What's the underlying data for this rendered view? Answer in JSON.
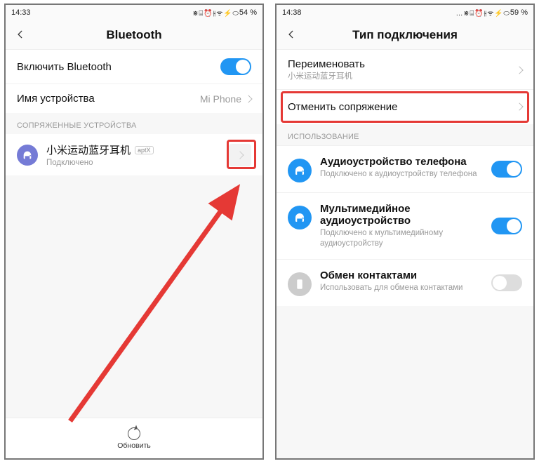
{
  "left": {
    "status": {
      "time": "14:33",
      "battery": "54 %",
      "icons": "⋇ ⌸ ⏰ ⫳ ᯤ ⚡ ⬭"
    },
    "header": {
      "title": "Bluetooth"
    },
    "rows": {
      "enable": "Включить Bluetooth",
      "device_name_label": "Имя устройства",
      "device_name_value": "Mi Phone"
    },
    "section_paired": "СОПРЯЖЕННЫЕ УСТРОЙСТВА",
    "device": {
      "name": "小米运动蓝牙耳机",
      "badge": "aptX",
      "status": "Подключено"
    },
    "bottom": {
      "refresh": "Обновить"
    }
  },
  "right": {
    "status": {
      "time": "14:38",
      "battery": "59 %",
      "icons": "… ⋇ ⌸ ⏰ ⫳ ᯤ ⚡ ⬭"
    },
    "header": {
      "title": "Тип подключения"
    },
    "rename": {
      "label": "Переименовать",
      "sub": "小米运动蓝牙耳机"
    },
    "unpair": {
      "label": "Отменить сопряжение"
    },
    "section_usage": "ИСПОЛЬЗОВАНИЕ",
    "usage": {
      "phone_audio": {
        "title": "Аудиоустройство телефона",
        "sub": "Подключено к аудиоустройству телефона"
      },
      "media_audio": {
        "title": "Мультимедийное аудиоустройство",
        "sub": "Подключено к мультимедийному аудиоустройству"
      },
      "contacts": {
        "title": "Обмен контактами",
        "sub": "Использовать для обмена контактами"
      }
    }
  }
}
